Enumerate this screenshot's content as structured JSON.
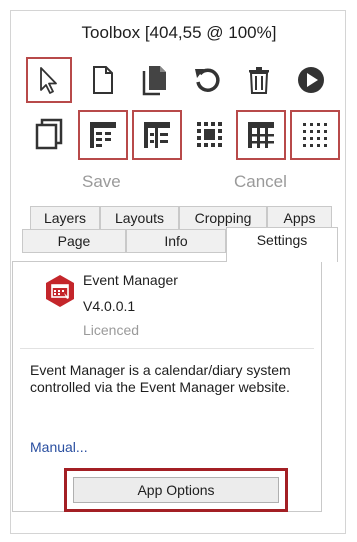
{
  "window": {
    "title": "Toolbox [404,55 @ 100%]"
  },
  "toolbar": {
    "row1": [
      {
        "name": "select-pointer-icon"
      },
      {
        "name": "new-page-icon"
      },
      {
        "name": "copy-pages-icon"
      },
      {
        "name": "refresh-icon"
      },
      {
        "name": "delete-icon"
      },
      {
        "name": "play-icon"
      }
    ],
    "row2": [
      {
        "name": "page-frame-icon"
      },
      {
        "name": "layout-grid-a-icon"
      },
      {
        "name": "layout-grid-b-icon"
      },
      {
        "name": "dotted-square-icon"
      },
      {
        "name": "layout-grid-c-icon"
      },
      {
        "name": "dot-grid-icon"
      }
    ],
    "save_label": "Save",
    "cancel_label": "Cancel"
  },
  "tabs": {
    "row1": [
      "Layers",
      "Layouts",
      "Cropping",
      "Apps"
    ],
    "row2": [
      "Page",
      "Info",
      "Settings"
    ],
    "active": "Settings"
  },
  "app": {
    "icon": "event-manager-logo",
    "name": "Event Manager",
    "version": "V4.0.0.1",
    "license": "Licenced",
    "description": "Event Manager is a calendar/diary system controlled via the Event Manager website.",
    "manual_link": "Manual...",
    "options_button": "App Options"
  },
  "colors": {
    "selection_border": "#b84a4a",
    "highlight_border": "#a31f24",
    "link": "#2a4fa0",
    "logo": "#c4262b"
  }
}
